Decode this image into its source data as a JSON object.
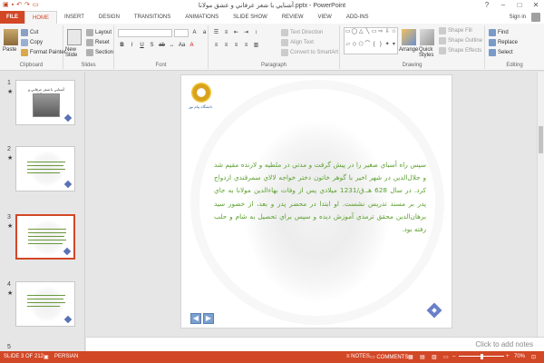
{
  "window": {
    "title": "آشنايي با شعر عرفاني و عشق مولانا.pptx - PowerPoint",
    "controls": [
      "?",
      "–",
      "□",
      "✕"
    ]
  },
  "tabs": [
    "FILE",
    "HOME",
    "INSERT",
    "DESIGN",
    "TRANSITIONS",
    "ANIMATIONS",
    "SLIDE SHOW",
    "REVIEW",
    "VIEW",
    "ADD-INS"
  ],
  "active_tab": "HOME",
  "sign_in": "Sign in",
  "ribbon": {
    "clipboard": {
      "paste": "Paste",
      "cut": "Cut",
      "copy": "Copy",
      "format_painter": "Format Painter",
      "label": "Clipboard"
    },
    "slides": {
      "new_slide": "New Slide",
      "layout": "Layout",
      "reset": "Reset",
      "section": "Section",
      "label": "Slides"
    },
    "font": {
      "label": "Font",
      "font_name": "",
      "font_size": ""
    },
    "paragraph": {
      "text_direction": "Text Direction",
      "align_text": "Align Text",
      "convert_smartart": "Convert to SmartArt",
      "label": "Paragraph"
    },
    "drawing": {
      "arrange": "Arrange",
      "quick_styles": "Quick Styles",
      "shape_fill": "Shape Fill",
      "shape_outline": "Shape Outline",
      "shape_effects": "Shape Effects",
      "label": "Drawing"
    },
    "editing": {
      "find": "Find",
      "replace": "Replace",
      "select": "Select",
      "label": "Editing"
    }
  },
  "thumbnails": [
    {
      "num": "1",
      "title": "آشنايي با شعر عرفاني و عشق مولانا"
    },
    {
      "num": "2"
    },
    {
      "num": "3",
      "selected": true
    },
    {
      "num": "4"
    },
    {
      "num": "5"
    }
  ],
  "slide": {
    "logo_caption": "دانشگاه پيام نور",
    "body": "سپس راه أسباي صغير را در پيش گرفت و مدتي در ملطيه و لارنده مقيم شد و جلال‌الدين در شهر اخير با گوهر خاتون دختر خواجه لالاي سمرقندي ازدواج كرد. در سال 628 هـ.ق/1231 ميلادي پس از وفات بهاءالدين مولانا به جاي پدر بر مسند تدريس نشست. او ابتدا در محضر پدر و بعد، از حضور سيد برهان‌الدين محقق ترمذي آموزش ديده و سپس براي تحصيل به شام و حلب رفته بود."
  },
  "notes_placeholder": "Click to add notes",
  "status": {
    "slide_of": "SLIDE 3 OF 212",
    "language": "PERSIAN",
    "notes": "NOTES",
    "comments": "COMMENTS",
    "zoom": "70%"
  }
}
